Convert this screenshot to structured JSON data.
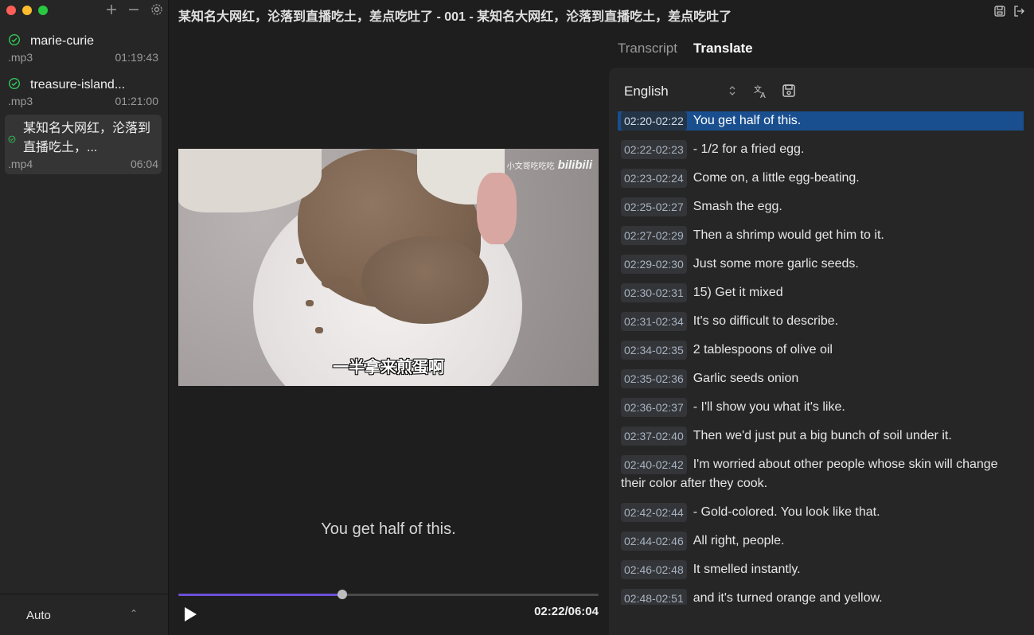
{
  "window": {
    "title": "某知名大网红，沦落到直播吃土，差点吃吐了 - 001 - 某知名大网红，沦落到直播吃土，差点吃吐了"
  },
  "sidebar": {
    "files": [
      {
        "name": "marie-curie",
        "ext": ".mp3",
        "duration": "01:19:43",
        "status": "done"
      },
      {
        "name": "treasure-island...",
        "ext": ".mp3",
        "duration": "01:21:00",
        "status": "done"
      },
      {
        "name": "某知名大网红，沦落到直播吃土，...",
        "ext": ".mp4",
        "duration": "06:04",
        "status": "done"
      }
    ],
    "language_select": "Auto"
  },
  "player": {
    "video_subtitle": "一半拿来煎蛋啊",
    "watermark": "小文哥吃吃吃",
    "watermark_brand": "bilibili",
    "caption": "You get half of this.",
    "current_time": "02:22",
    "total_time": "06:04",
    "time_display": "02:22/06:04",
    "progress": 0.39
  },
  "panel": {
    "tabs": [
      {
        "label": "Transcript",
        "active": false
      },
      {
        "label": "Translate",
        "active": true
      }
    ],
    "target_language": "English",
    "segments": [
      {
        "time": "02:20-02:22",
        "text": "You get half of this.",
        "active": true
      },
      {
        "time": "02:22-02:23",
        "text": "- 1/2 for a fried egg."
      },
      {
        "time": "02:23-02:24",
        "text": "Come on, a little egg-beating."
      },
      {
        "time": "02:25-02:27",
        "text": "Smash the egg."
      },
      {
        "time": "02:27-02:29",
        "text": "Then a shrimp would get him to it."
      },
      {
        "time": "02:29-02:30",
        "text": "Just some more garlic seeds."
      },
      {
        "time": "02:30-02:31",
        "text": "15) Get it mixed"
      },
      {
        "time": "02:31-02:34",
        "text": "It's so difficult to describe."
      },
      {
        "time": "02:34-02:35",
        "text": "2 tablespoons of olive oil"
      },
      {
        "time": "02:35-02:36",
        "text": "Garlic seeds onion"
      },
      {
        "time": "02:36-02:37",
        "text": "- I'll show you what it's like."
      },
      {
        "time": "02:37-02:40",
        "text": "Then we'd just put a big bunch of soil under it."
      },
      {
        "time": "02:40-02:42",
        "text": "I'm worried about other people whose skin will change their color after they cook."
      },
      {
        "time": "02:42-02:44",
        "text": "- Gold-colored. You look like that."
      },
      {
        "time": "02:44-02:46",
        "text": "All right, people."
      },
      {
        "time": "02:46-02:48",
        "text": "It smelled instantly."
      },
      {
        "time": "02:48-02:51",
        "text": "and it's turned orange and yellow."
      }
    ]
  },
  "colors": {
    "accent": "#6b4fd8",
    "selection": "#1a4f8f",
    "check": "#34c759"
  }
}
